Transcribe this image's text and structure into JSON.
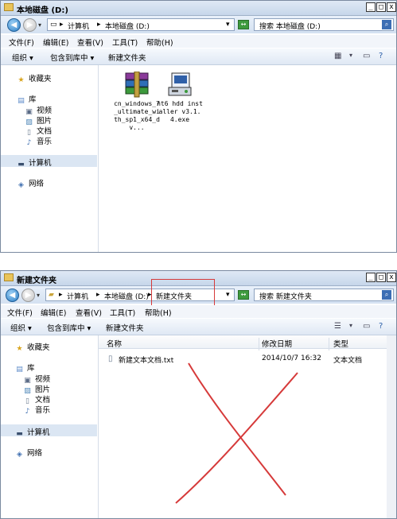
{
  "top": {
    "title": "本地磁盘 (D:)",
    "address": [
      "计算机",
      "本地磁盘 (D:)"
    ],
    "search_placeholder": "搜索 本地磁盘 (D:)",
    "menus": [
      "文件(F)",
      "编辑(E)",
      "查看(V)",
      "工具(T)",
      "帮助(H)"
    ],
    "commands": [
      "组织",
      "包含到库中",
      "新建文件夹"
    ],
    "nav": {
      "favorites": "收藏夹",
      "libraries": "库",
      "lib_items": [
        "视频",
        "图片",
        "文档",
        "音乐"
      ],
      "computer": "计算机",
      "network": "网络"
    },
    "files": [
      {
        "name": "cn_windows_7_ultimate_with_sp1_x64_dv...",
        "icon": "rar-archive-icon"
      },
      {
        "name": "nt6 hdd installer v3.1.4.exe",
        "icon": "installer-exe-icon"
      }
    ]
  },
  "bottom": {
    "title": "新建文件夹",
    "address": [
      "计算机",
      "本地磁盘 (D:)",
      "新建文件夹"
    ],
    "search_placeholder": "搜索 新建文件夹",
    "menus": [
      "文件(F)",
      "编辑(E)",
      "查看(V)",
      "工具(T)",
      "帮助(H)"
    ],
    "commands": [
      "组织",
      "包含到库中",
      "新建文件夹"
    ],
    "nav": {
      "favorites": "收藏夹",
      "libraries": "库",
      "lib_items": [
        "视频",
        "图片",
        "文档",
        "音乐"
      ],
      "computer": "计算机",
      "network": "网络"
    },
    "columns": [
      "名称",
      "修改日期",
      "类型"
    ],
    "rows": [
      {
        "name": "新建文本文档.txt",
        "date": "2014/10/7 16:32",
        "type": "文本文档"
      }
    ]
  },
  "colors": {
    "annotation_red": "#d63a3a",
    "selection": "#dbe6f3",
    "titlebar": "#c6d6ea"
  }
}
